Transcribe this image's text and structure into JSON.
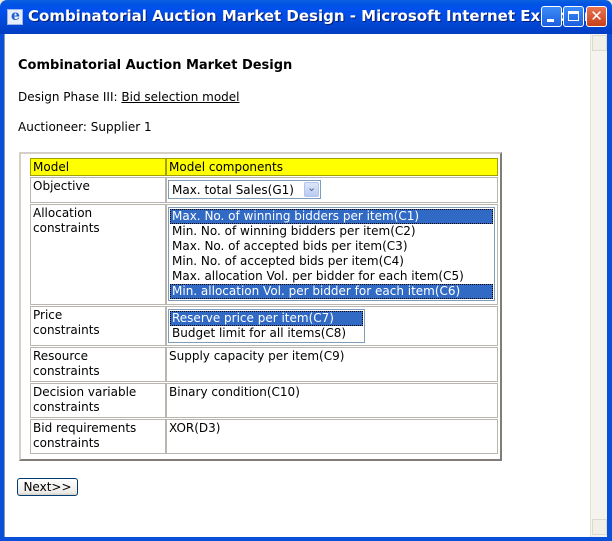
{
  "window": {
    "title": "Combinatorial Auction Market Design - Microsoft Internet Explorer",
    "buttons": [
      "minimize",
      "maximize",
      "close"
    ]
  },
  "page": {
    "heading": "Combinatorial Auction Market Design",
    "phase_prefix": "Design Phase III: ",
    "phase_link": "Bid selection model",
    "auctioneer": "Auctioneer: Supplier 1"
  },
  "table": {
    "headers": {
      "model": "Model",
      "components": "Model components"
    },
    "objective": {
      "label": "Objective",
      "selected": "Max. total Sales(G1)"
    },
    "allocation": {
      "label_line1": "Allocation",
      "label_line2": "constraints",
      "options": [
        {
          "text": "Max. No. of winning bidders per item(C1)",
          "selected": true
        },
        {
          "text": "Min. No. of winning bidders per item(C2)",
          "selected": false
        },
        {
          "text": "Max. No. of accepted bids per item(C3)",
          "selected": false
        },
        {
          "text": "Min. No. of accepted bids per item(C4)",
          "selected": false
        },
        {
          "text": "Max. allocation Vol. per bidder for each item(C5)",
          "selected": false
        },
        {
          "text": "Min. allocation Vol. per bidder for each item(C6)",
          "selected": true
        }
      ]
    },
    "price": {
      "label_line1": "Price",
      "label_line2": "constraints",
      "options": [
        {
          "text": "Reserve price per item(C7)",
          "selected": true
        },
        {
          "text": "Budget limit for all items(C8)",
          "selected": false
        }
      ]
    },
    "resource": {
      "label_line1": "Resource",
      "label_line2": "constraints",
      "value": "Supply capacity per item(C9)"
    },
    "decision": {
      "label_line1": "Decision variable",
      "label_line2": "constraints",
      "value": "Binary condition(C10)"
    },
    "bid": {
      "label_line1": "Bid requirements",
      "label_line2": "constraints",
      "value": "XOR(D3)"
    }
  },
  "next_button": "Next>>",
  "colors": {
    "header_bg": "#ffff00",
    "selection": "#316ac5",
    "titlebar": "#0054e3"
  }
}
